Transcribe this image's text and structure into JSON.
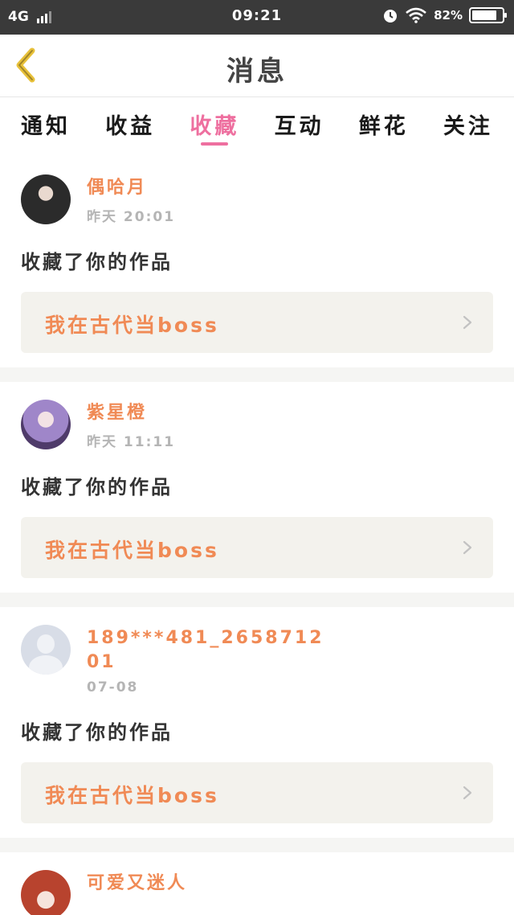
{
  "status_bar": {
    "network": "4G",
    "time": "09:21",
    "battery_text": "82%",
    "battery_level": 0.82
  },
  "header": {
    "title": "消息",
    "back_icon": "chevron-left-icon"
  },
  "tabs": [
    {
      "label": "通知",
      "active": false
    },
    {
      "label": "收益",
      "active": false
    },
    {
      "label": "收藏",
      "active": true
    },
    {
      "label": "互动",
      "active": false
    },
    {
      "label": "鲜花",
      "active": false
    },
    {
      "label": "关注",
      "active": false
    }
  ],
  "messages": [
    {
      "user": "偶哈月",
      "time": "昨天 20:01",
      "action": "收藏了你的作品",
      "work": "我在古代当boss"
    },
    {
      "user": "紫星橙",
      "time": "昨天 11:11",
      "action": "收藏了你的作品",
      "work": "我在古代当boss"
    },
    {
      "user": "189***481_265871201",
      "time": "07-08",
      "action": "收藏了你的作品",
      "work": "我在古代当boss"
    },
    {
      "user": "可爱又迷人",
      "time": "",
      "action": "",
      "work": ""
    }
  ],
  "colors": {
    "accent_pink": "#ee6f9f",
    "accent_orange": "#f08a55",
    "status_bar": "#3a3a3a"
  }
}
